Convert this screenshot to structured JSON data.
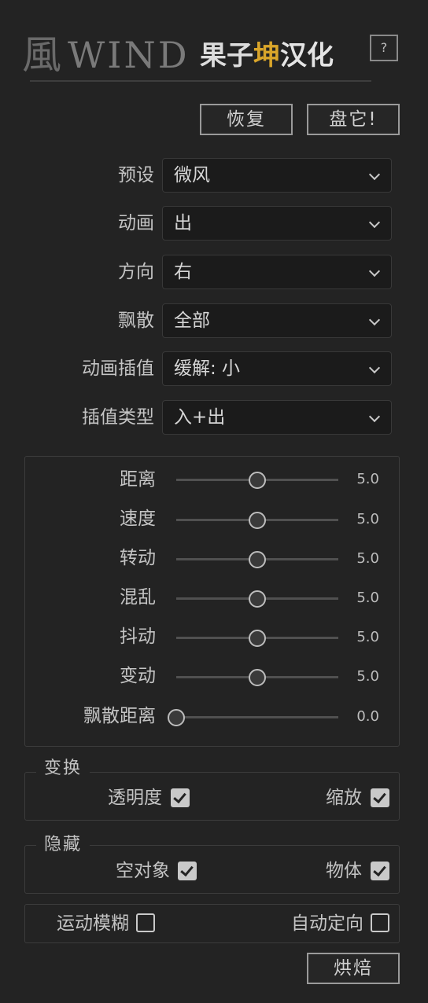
{
  "header": {
    "logo_char": "風",
    "logo_text": "WIND",
    "subtitle_1": "果子",
    "subtitle_2": "坤",
    "subtitle_3": "汉化",
    "help_label": "?"
  },
  "actions": {
    "reset_label": "恢复",
    "apply_label": "盘它!",
    "bake_label": "烘焙"
  },
  "dropdowns": [
    {
      "label": "预设",
      "value": "微风"
    },
    {
      "label": "动画",
      "value": "出"
    },
    {
      "label": "方向",
      "value": "右"
    },
    {
      "label": "飘散",
      "value": "全部"
    },
    {
      "label": "动画插值",
      "value": "缓解: 小"
    },
    {
      "label": "插值类型",
      "value": "入+出"
    }
  ],
  "sliders": [
    {
      "label": "距离",
      "value": "5.0",
      "fraction": 0.5
    },
    {
      "label": "速度",
      "value": "5.0",
      "fraction": 0.5
    },
    {
      "label": "转动",
      "value": "5.0",
      "fraction": 0.5
    },
    {
      "label": "混乱",
      "value": "5.0",
      "fraction": 0.5
    },
    {
      "label": "抖动",
      "value": "5.0",
      "fraction": 0.5
    },
    {
      "label": "变动",
      "value": "5.0",
      "fraction": 0.5
    },
    {
      "label": "飘散距离",
      "value": "0.0",
      "fraction": 0.0
    }
  ],
  "transform": {
    "title": "变换",
    "opacity": {
      "label": "透明度",
      "checked": true
    },
    "scale": {
      "label": "缩放",
      "checked": true
    }
  },
  "hide": {
    "title": "隐藏",
    "null_object": {
      "label": "空对象",
      "checked": true
    },
    "object": {
      "label": "物体",
      "checked": true
    }
  },
  "options": {
    "motion_blur": {
      "label": "运动模糊",
      "checked": false
    },
    "auto_orient": {
      "label": "自动定向",
      "checked": false
    }
  },
  "colors": {
    "accent": "#d9a52a",
    "background": "#232323",
    "field": "#1b1b1b"
  }
}
